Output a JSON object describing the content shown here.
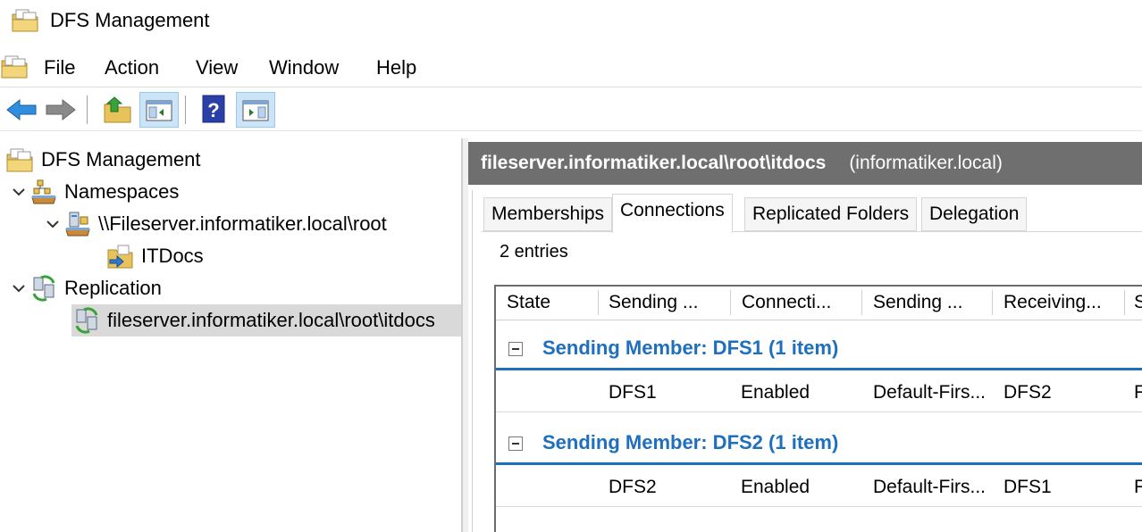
{
  "window": {
    "title": "DFS Management"
  },
  "menu": [
    "File",
    "Action",
    "View",
    "Window",
    "Help"
  ],
  "toolbar": {
    "buttons": [
      "back-icon",
      "forward-icon",
      "up-folder-icon",
      "show-hide-tree-icon",
      "help-icon",
      "show-hide-action-pane-icon"
    ]
  },
  "tree": {
    "root": "DFS Management",
    "namespaces": "Namespaces",
    "namespace_root": "\\\\Fileserver.informatiker.local\\root",
    "folder": "ITDocs",
    "replication": "Replication",
    "replication_group": "fileserver.informatiker.local\\root\\itdocs"
  },
  "details": {
    "path": "fileserver.informatiker.local\\root\\itdocs",
    "domain": "(informatiker.local)",
    "tabs": [
      "Memberships",
      "Connections",
      "Replicated Folders",
      "Delegation"
    ],
    "active_tab": "Connections",
    "entries": "2 entries",
    "columns": [
      "State",
      "Sending ...",
      "Connecti...",
      "Sending ...",
      "Receiving...",
      "S"
    ],
    "groups": [
      {
        "label": "Sending Member: DFS1 (1 item)",
        "row": {
          "sending": "DFS1",
          "state": "Enabled",
          "site": "Default-Firs...",
          "receiving": "DFS2",
          "extra": "F"
        }
      },
      {
        "label": "Sending Member: DFS2 (1 item)",
        "row": {
          "sending": "DFS2",
          "state": "Enabled",
          "site": "Default-Firs...",
          "receiving": "DFS1",
          "extra": "F"
        }
      }
    ]
  },
  "colors": {
    "accent": "#1f6fbf",
    "header_band": "#6f6f6f",
    "selection": "#d9d9d9",
    "toolbar_pressed": "#cce4f7"
  }
}
